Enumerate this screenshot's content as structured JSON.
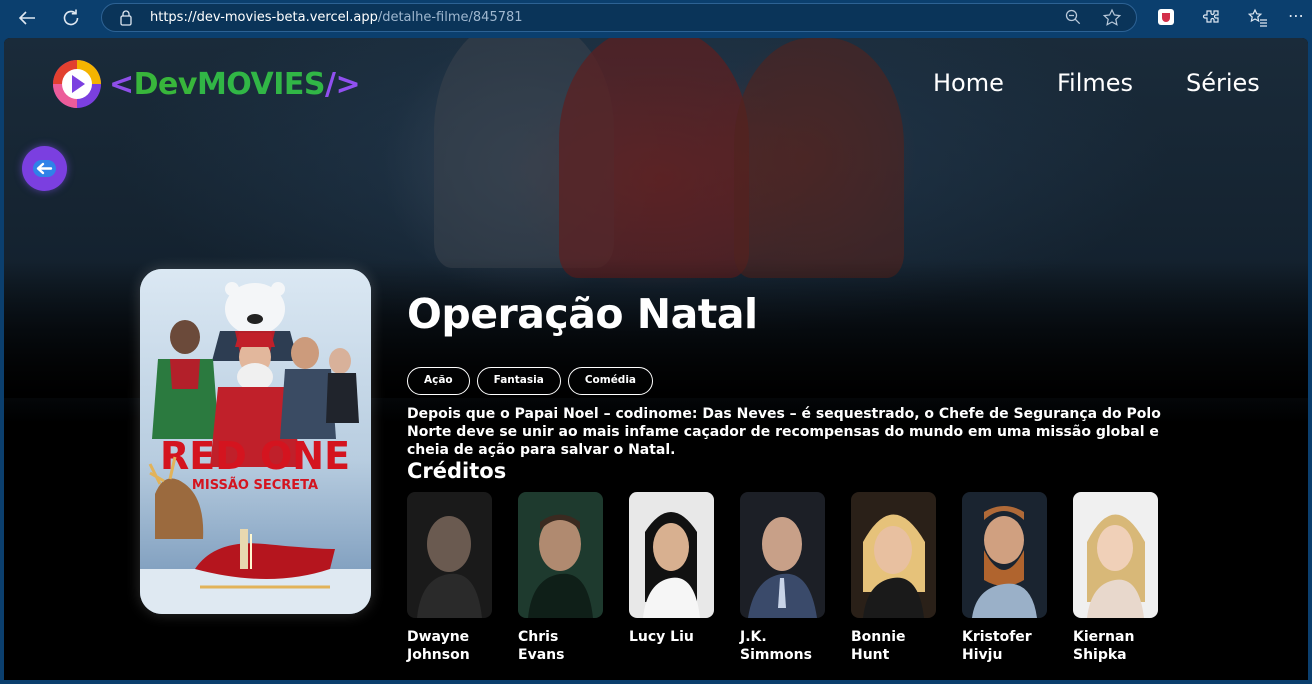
{
  "browser": {
    "url_host": "https://dev-movies-beta.vercel.app",
    "url_path": "/detalhe-filme/845781"
  },
  "header": {
    "logo": {
      "lt": "<",
      "text_dev": "Dev",
      "text_movies": "MOVIES",
      "slash": "/>"
    },
    "menu": [
      {
        "label": "Home"
      },
      {
        "label": "Filmes"
      },
      {
        "label": "Séries"
      }
    ]
  },
  "movie": {
    "title": "Operação Natal",
    "poster": {
      "line1": "RED ONE",
      "line2": "MISSÃO SECRETA"
    },
    "genres": [
      "Ação",
      "Fantasia",
      "Comédia"
    ],
    "overview": "Depois que o Papai Noel – codinome: Das Neves – é sequestrado, o Chefe de Segurança do Polo Norte deve se unir ao mais infame caçador de recompensas do mundo em uma missão global e cheia de ação para salvar o Natal."
  },
  "credits": {
    "title": "Créditos",
    "cast": [
      {
        "name": "Dwayne Johnson",
        "bg": "#1a1a1a",
        "skin": "#6a5a50"
      },
      {
        "name": "Chris Evans",
        "bg": "#1e3a2e",
        "skin": "#b08a70"
      },
      {
        "name": "Lucy Liu",
        "bg": "#e8e8e8",
        "skin": "#d8b090"
      },
      {
        "name": "J.K. Simmons",
        "bg": "#1c1f26",
        "skin": "#c8a088"
      },
      {
        "name": "Bonnie Hunt",
        "bg": "#2a2018",
        "skin": "#e8c0a0"
      },
      {
        "name": "Kristofer Hivju",
        "bg": "#1a2430",
        "skin": "#d0a080"
      },
      {
        "name": "Kiernan Shipka",
        "bg": "#f0f0f0",
        "skin": "#f0d0b8"
      }
    ]
  },
  "colors": {
    "chrome": "#0b3f6e",
    "accent_purple": "#7b3fe0",
    "logo_green": "#31b646"
  },
  "icons": [
    "back-arrow-icon",
    "refresh-icon",
    "lock-icon",
    "zoom-out-icon",
    "favorite-star-icon",
    "extension-icon",
    "favorites-list-icon",
    "more-icon",
    "back-button-arrow-icon"
  ]
}
